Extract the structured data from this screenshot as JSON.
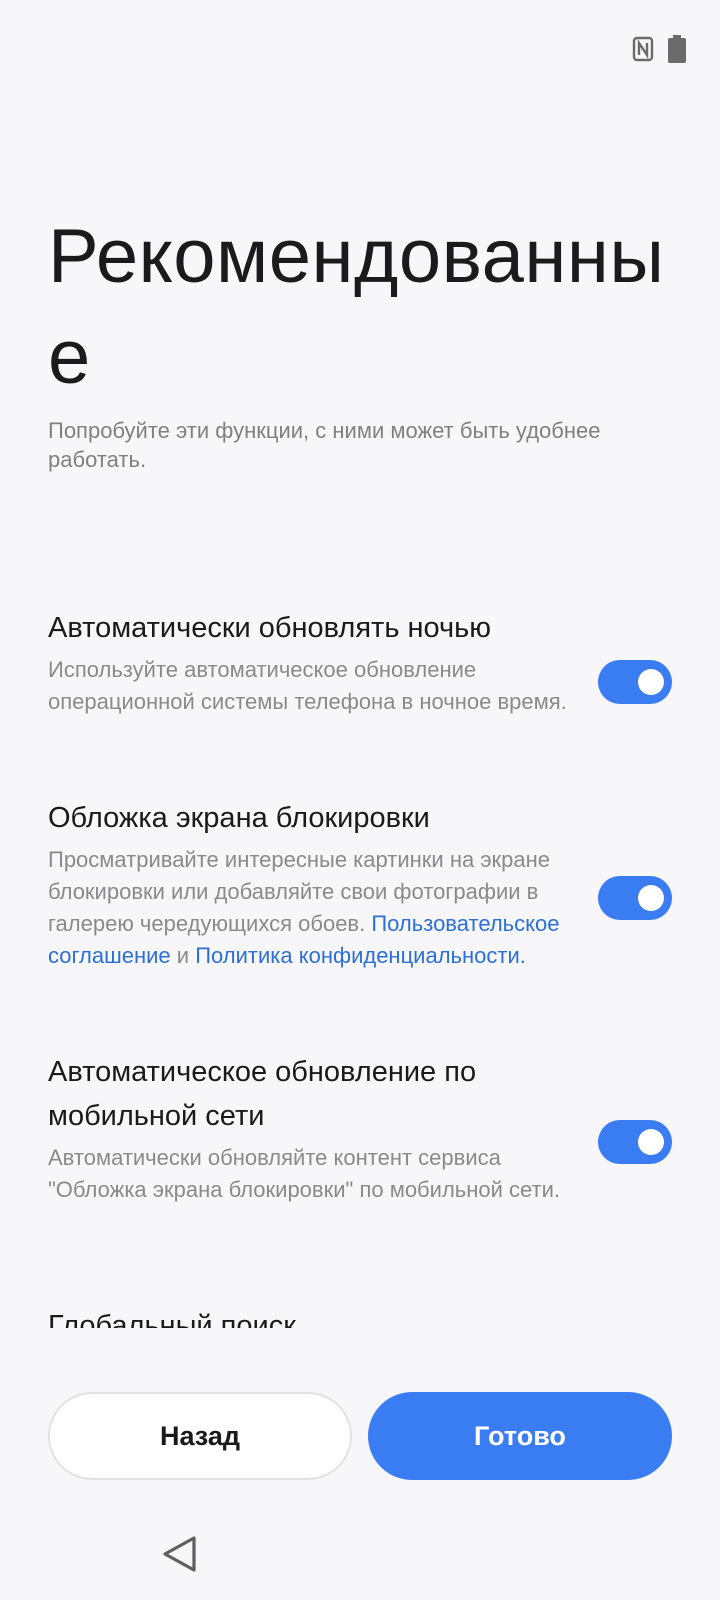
{
  "status_bar": {
    "icons": [
      "nfc-icon",
      "battery-icon"
    ]
  },
  "header": {
    "title": "Рекомендованные",
    "subtitle": "Попробуйте эти функции, с ними может быть удобнее работать."
  },
  "settings": [
    {
      "title": "Автоматически обновлять ночью",
      "description": "Используйте автоматическое обновление операционной системы телефона в ночное время.",
      "enabled": true
    },
    {
      "title": "Обложка экрана блокировки",
      "description": "Просматривайте интересные картинки на экране блокировки или добавляйте свои фотографии в галерею чередующихся обоев.",
      "link_user_agreement": "Пользовательское соглашение",
      "conjunction": "и",
      "link_privacy_policy": "Политика конфиденциальности",
      "trailing": ".",
      "enabled": true
    },
    {
      "title": "Автоматическое обновление по мобильной сети",
      "description": "Автоматически обновляйте контент сервиса \"Обложка экрана блокировки\" по мобильной сети.",
      "enabled": true
    },
    {
      "title": "Глобальный поиск"
    }
  ],
  "buttons": {
    "back": "Назад",
    "done": "Готово"
  },
  "colors": {
    "accent": "#3a7cf2",
    "link": "#2d6fd6",
    "background": "#f7f7f9"
  },
  "nav": {
    "icons": [
      "back-triangle-icon"
    ]
  }
}
